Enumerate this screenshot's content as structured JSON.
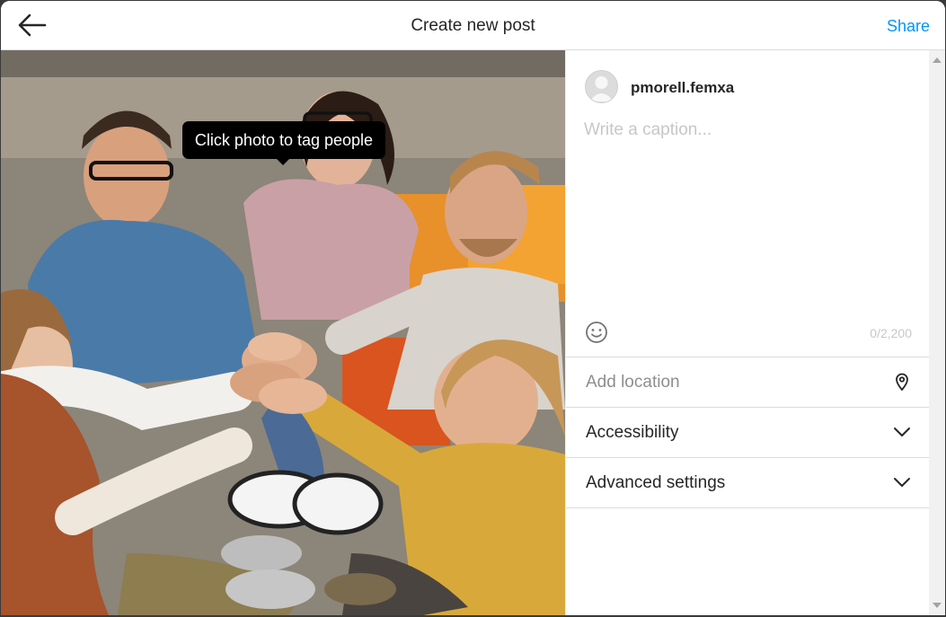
{
  "header": {
    "title": "Create new post",
    "share_label": "Share",
    "back_icon": "arrow-left-icon"
  },
  "photo": {
    "tooltip": "Click photo to tag people"
  },
  "post": {
    "username": "pmorell.femxa",
    "caption_placeholder": "Write a caption...",
    "caption_value": "",
    "char_count": "0/2,200",
    "emoji_icon": "smiley-icon"
  },
  "options": {
    "location_placeholder": "Add location",
    "location_icon": "map-pin-icon",
    "accessibility_label": "Accessibility",
    "advanced_label": "Advanced settings",
    "chevron_icon": "chevron-down-icon"
  },
  "colors": {
    "accent": "#0095f6",
    "text": "#262626",
    "placeholder": "#c7c7c7",
    "border": "#dbdbdb"
  }
}
